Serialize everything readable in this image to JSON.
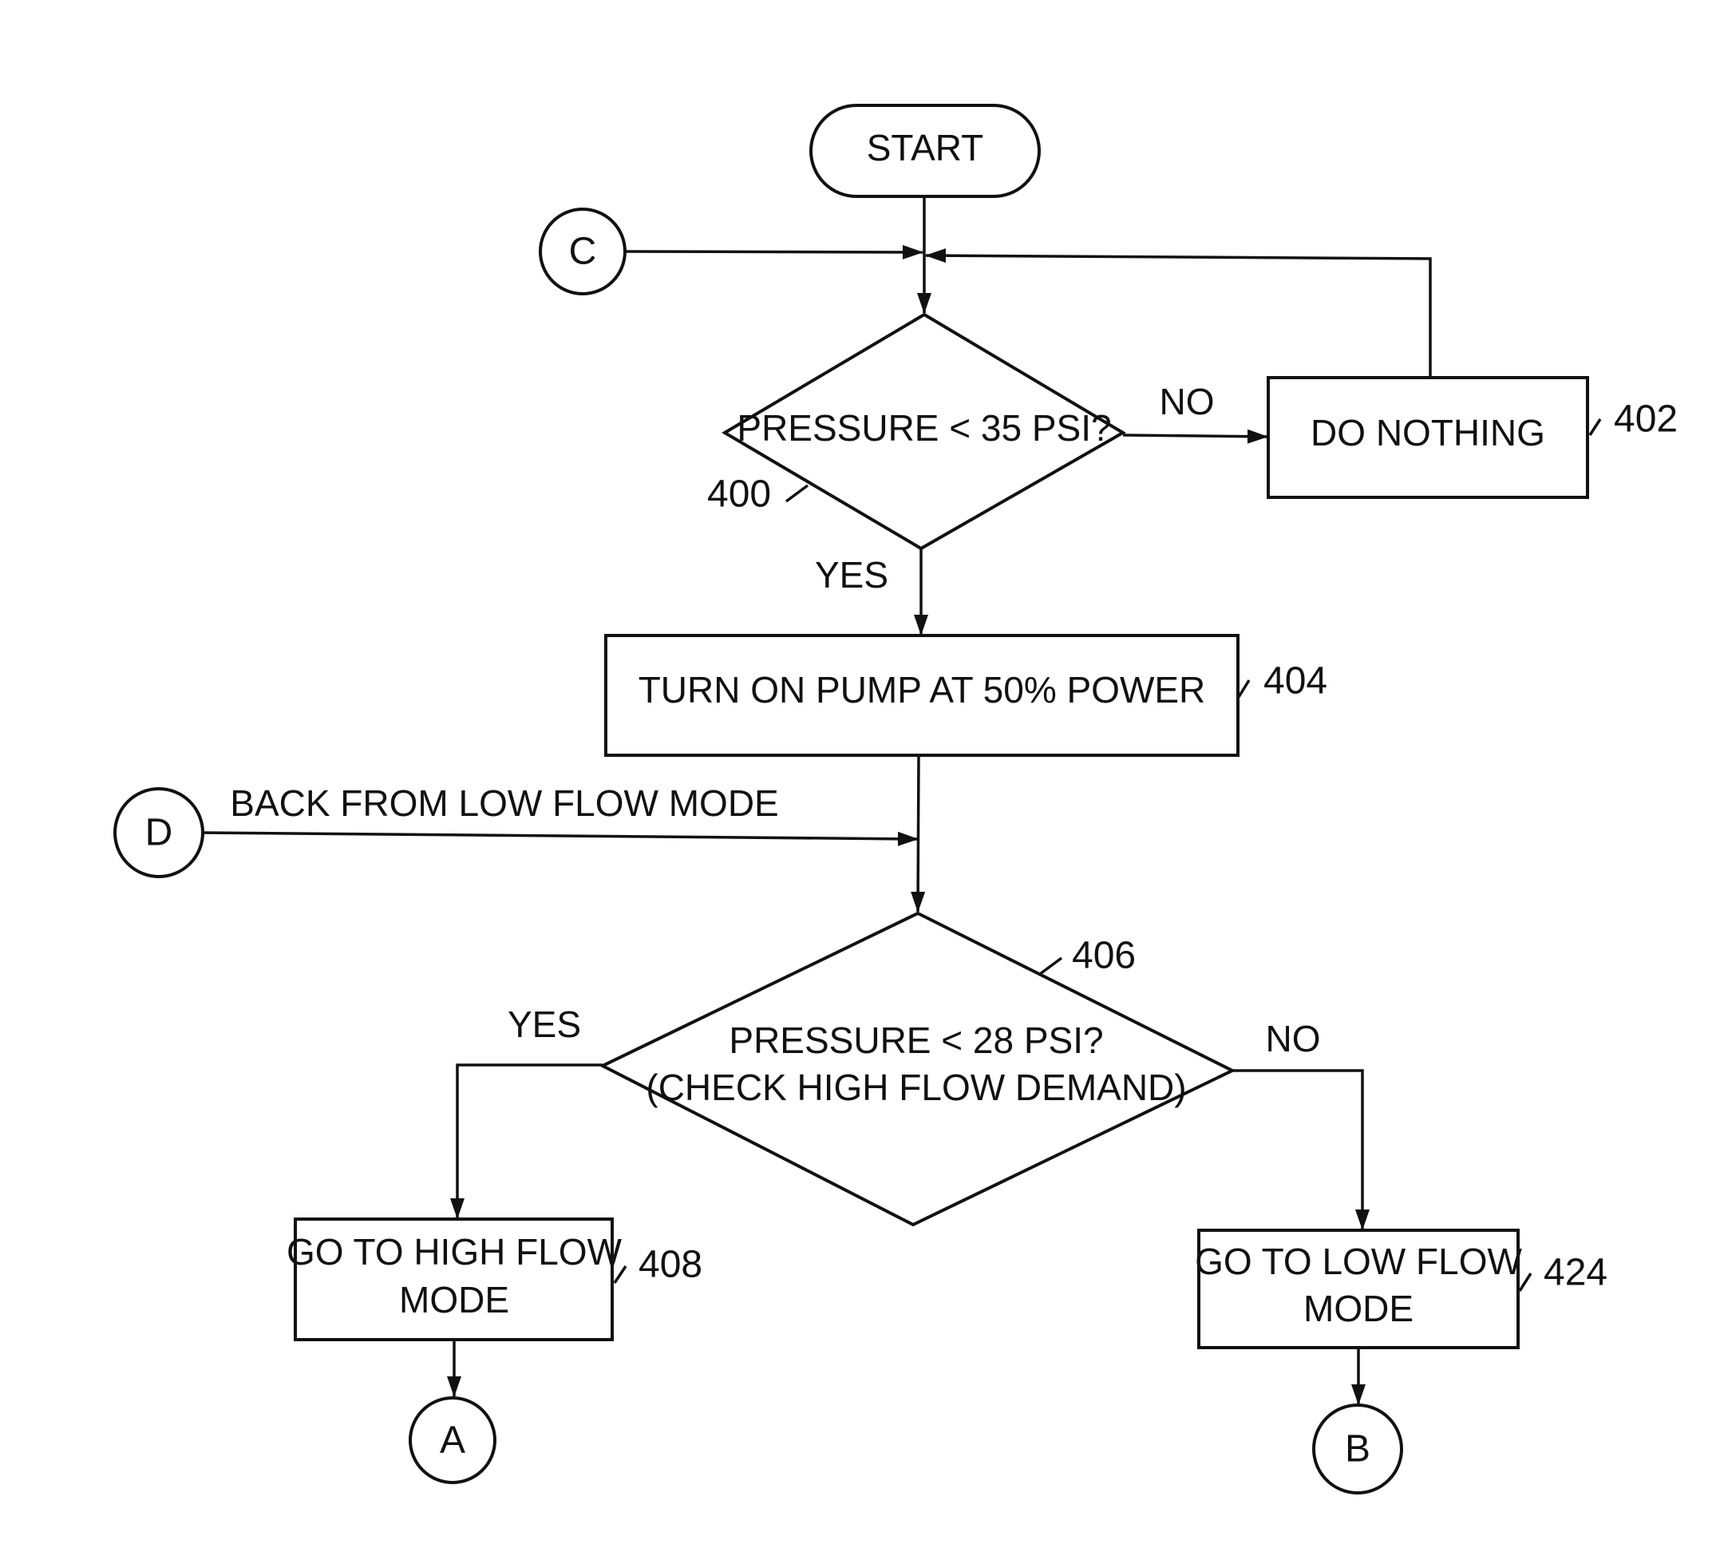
{
  "diagram": {
    "type": "flowchart",
    "nodes": {
      "start": {
        "label": "START"
      },
      "decision_400": {
        "label": "PRESSURE < 35 PSI?",
        "ref": "400"
      },
      "do_nothing": {
        "label": "DO NOTHING",
        "ref": "402"
      },
      "turn_on_pump": {
        "label": "TURN ON PUMP AT 50% POWER",
        "ref": "404"
      },
      "decision_406": {
        "line1": "PRESSURE < 28 PSI?",
        "line2": "(CHECK HIGH FLOW DEMAND)",
        "ref": "406"
      },
      "high_flow": {
        "line1": "GO TO HIGH FLOW",
        "line2": "MODE",
        "ref": "408"
      },
      "low_flow": {
        "line1": "GO TO LOW FLOW",
        "line2": "MODE",
        "ref": "424"
      }
    },
    "connectors": {
      "A": "A",
      "B": "B",
      "C": "C",
      "D": "D"
    },
    "edge_labels": {
      "d400_no": "NO",
      "d400_yes": "YES",
      "d406_yes": "YES",
      "d406_no": "NO",
      "d_entry": "BACK FROM LOW FLOW MODE"
    }
  }
}
